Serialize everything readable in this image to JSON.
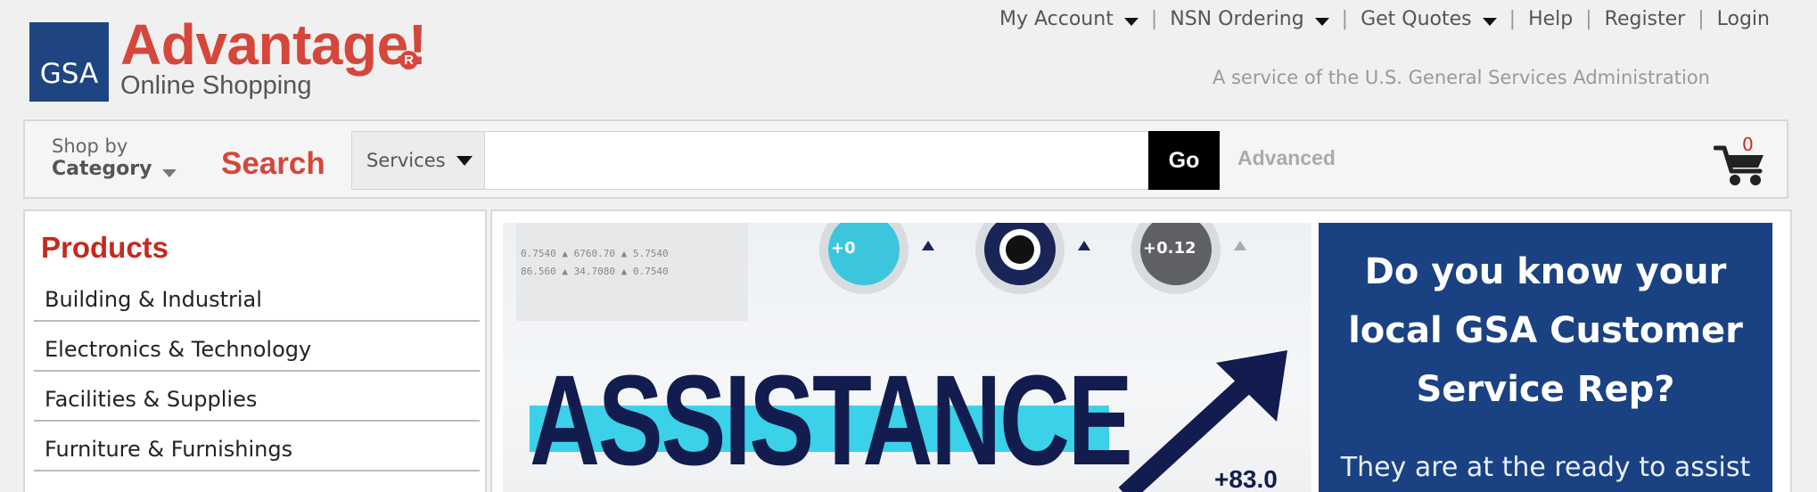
{
  "header": {
    "logo": {
      "mark_text": "GSA",
      "title": "Advantage!",
      "registered": "R",
      "subtitle": "Online Shopping"
    },
    "tagline": "A service of the U.S. General Services Administration",
    "nav": [
      {
        "label": "My Account",
        "dropdown": true
      },
      {
        "label": "NSN Ordering",
        "dropdown": true
      },
      {
        "label": "Get Quotes",
        "dropdown": true
      },
      {
        "label": "Help",
        "dropdown": false
      },
      {
        "label": "Register",
        "dropdown": false
      },
      {
        "label": "Login",
        "dropdown": false
      }
    ],
    "separator": "|"
  },
  "search": {
    "shop_by_line1": "Shop by",
    "shop_by_line2": "Category",
    "label": "Search",
    "scope": "Services",
    "input_value": "",
    "go_label": "Go",
    "advanced_label": "Advanced",
    "cart_count": "0"
  },
  "sidebar": {
    "title": "Products",
    "items": [
      "Building & Industrial",
      "Electronics & Technology",
      "Facilities & Supplies",
      "Furniture & Furnishings"
    ]
  },
  "banner": {
    "word": "ASSISTANCE",
    "figure": "+83.0",
    "chip_left": "+0",
    "chip_right": "+0.12"
  },
  "promo": {
    "heading_lines": [
      "Do you know your",
      "local GSA Customer",
      "Service Rep?"
    ],
    "body": "They are at the ready to assist"
  },
  "colors": {
    "brand_red": "#d4473a",
    "gsa_blue": "#1f4482",
    "promo_blue": "#1a4282",
    "go_black": "#000000"
  }
}
